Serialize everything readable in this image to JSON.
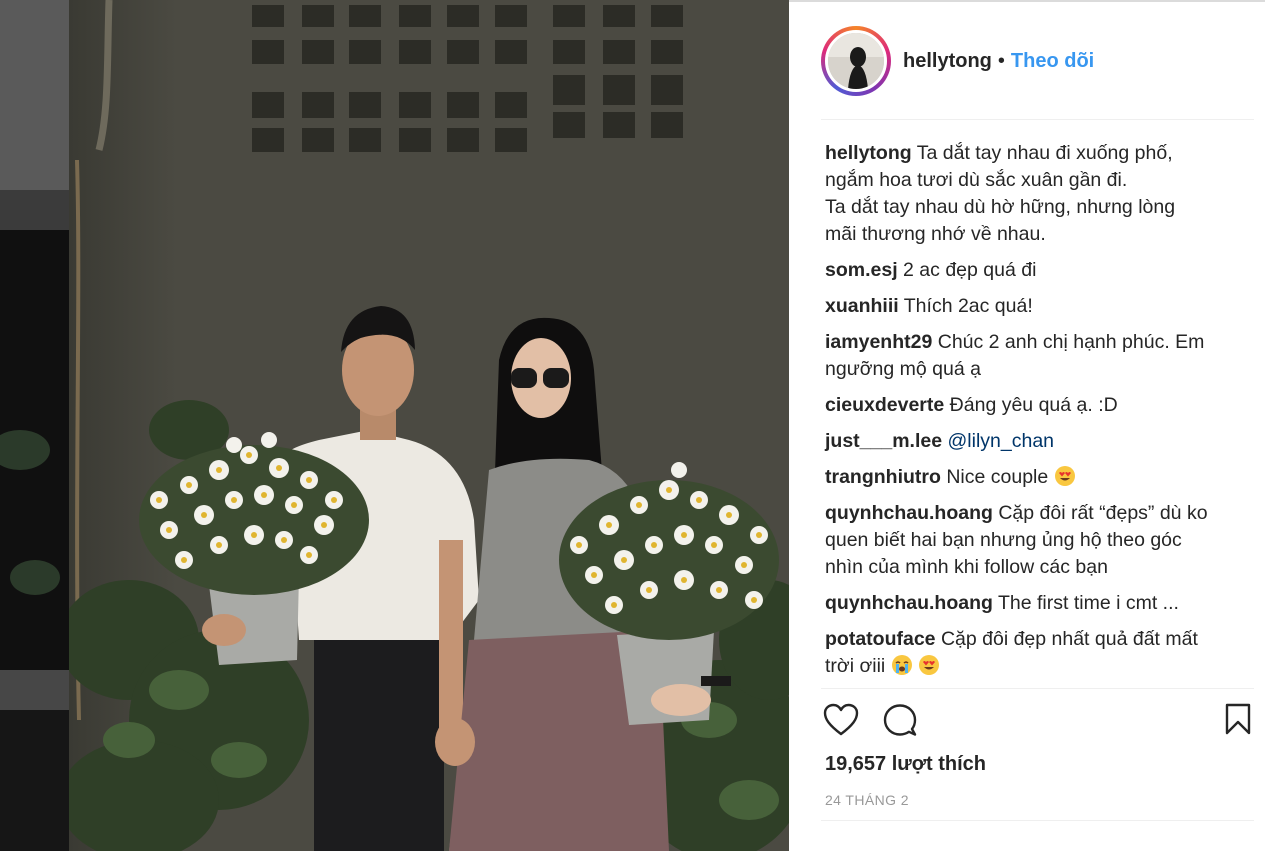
{
  "post": {
    "username": "hellytong",
    "separator": "•",
    "follow_label": "Theo dõi",
    "caption_lines": [
      "Ta dắt tay nhau đi xuống phố,",
      "ngắm hoa tươi dù sắc xuân gần đi.",
      "Ta dắt tay nhau dù hờ hững, nhưng lòng",
      "mãi thương nhớ về nhau."
    ]
  },
  "comments": [
    {
      "user": "som.esj",
      "text": "2 ac đẹp quá đi"
    },
    {
      "user": "xuanhiii",
      "text": "Thích 2ac quá!"
    },
    {
      "user": "iamyenht29",
      "text": "Chúc 2 anh chị hạnh phúc. Em ngưỡng mộ quá ạ"
    },
    {
      "user": "cieuxdeverte",
      "text": "Đáng yêu quá ạ. :D"
    },
    {
      "user": "just___m.lee",
      "mention": "@lilyn_chan"
    },
    {
      "user": "trangnhiutro",
      "text": "Nice couple",
      "emoji": "heart-eyes-emoji"
    },
    {
      "user": "quynhchau.hoang",
      "text": "Cặp đôi rất “đẹps” dù ko quen biết hai bạn nhưng ủng hộ theo góc nhìn của mình khi follow các bạn"
    },
    {
      "user": "quynhchau.hoang",
      "text": "The first time i cmt ..."
    },
    {
      "user": "potatouface",
      "text": "Cặp đôi đẹp nhất quả đất mất trời ơiii",
      "emoji": "crying-emoji heart-eyes-emoji"
    }
  ],
  "actions": {
    "like_icon": "heart-outline-icon",
    "comment_icon": "comment-bubble-icon",
    "save_icon": "bookmark-icon"
  },
  "likes_text": "19,657 lượt thích",
  "date_text": "24 THÁNG 2",
  "colors": {
    "follow": "#3897f0",
    "mention": "#003569",
    "text": "#262626",
    "muted": "#999999"
  }
}
